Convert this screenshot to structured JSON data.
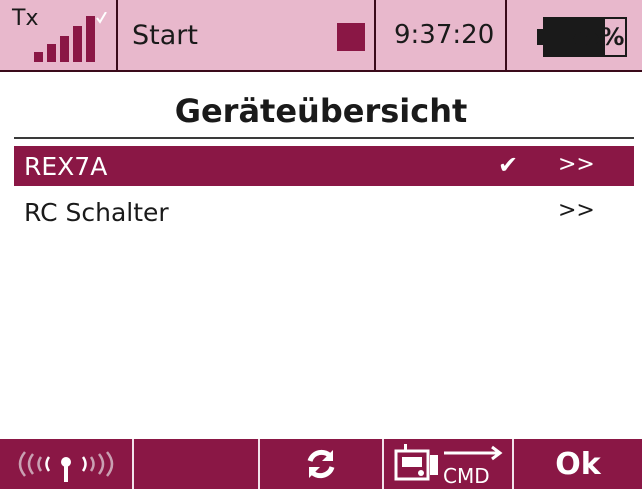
{
  "status_bar": {
    "tx_label": "Tx",
    "signal_bars": 5,
    "start_label": "Start",
    "time": "9:37:20",
    "battery_percent": "75%",
    "battery_level": 0.75
  },
  "page": {
    "title": "Geräteübersicht"
  },
  "devices": [
    {
      "label": "REX7A",
      "checked": true,
      "check_glyph": "✔",
      "arrow": ">>"
    },
    {
      "label": "RC Schalter",
      "checked": false,
      "check_glyph": "",
      "arrow": ">>"
    }
  ],
  "bottom_bar": {
    "ok_label": "Ok",
    "cmd_label": "CMD",
    "icons": [
      "wireless-signal-icon",
      "refresh-icon",
      "transmitter-command-icon"
    ]
  },
  "colors": {
    "accent": "#8a1745",
    "status_bg": "#e8b8cc"
  }
}
